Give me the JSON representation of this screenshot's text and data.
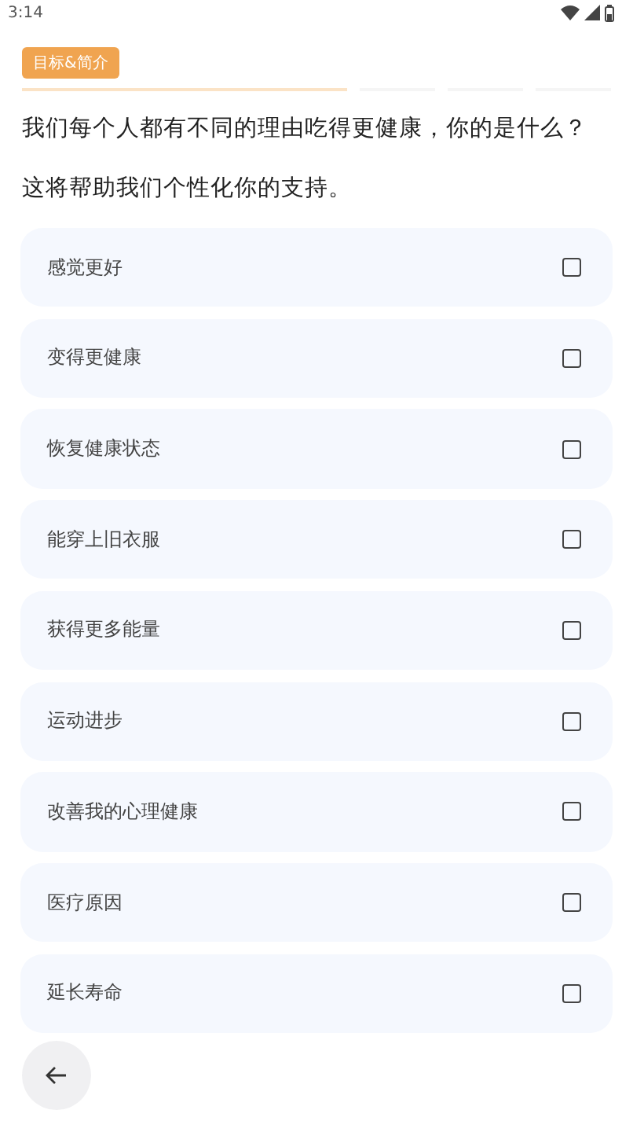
{
  "status_bar": {
    "time": "3:14"
  },
  "step_tag": "目标&简介",
  "progress": [
    {
      "level": 1
    },
    {
      "level": 0
    },
    {
      "level": 0
    },
    {
      "level": 0
    }
  ],
  "question": "我们每个人都有不同的理由吃得更健康，你的是什么？",
  "hint": "这将帮助我们个性化你的支持。",
  "options": [
    {
      "label": "感觉更好",
      "checked": false
    },
    {
      "label": "变得更健康",
      "checked": false
    },
    {
      "label": "恢复健康状态",
      "checked": false
    },
    {
      "label": "能穿上旧衣服",
      "checked": false
    },
    {
      "label": "获得更多能量",
      "checked": false
    },
    {
      "label": "运动进步",
      "checked": false
    },
    {
      "label": "改善我的心理健康",
      "checked": false
    },
    {
      "label": "医疗原因",
      "checked": false
    },
    {
      "label": "延长寿命",
      "checked": false
    }
  ]
}
